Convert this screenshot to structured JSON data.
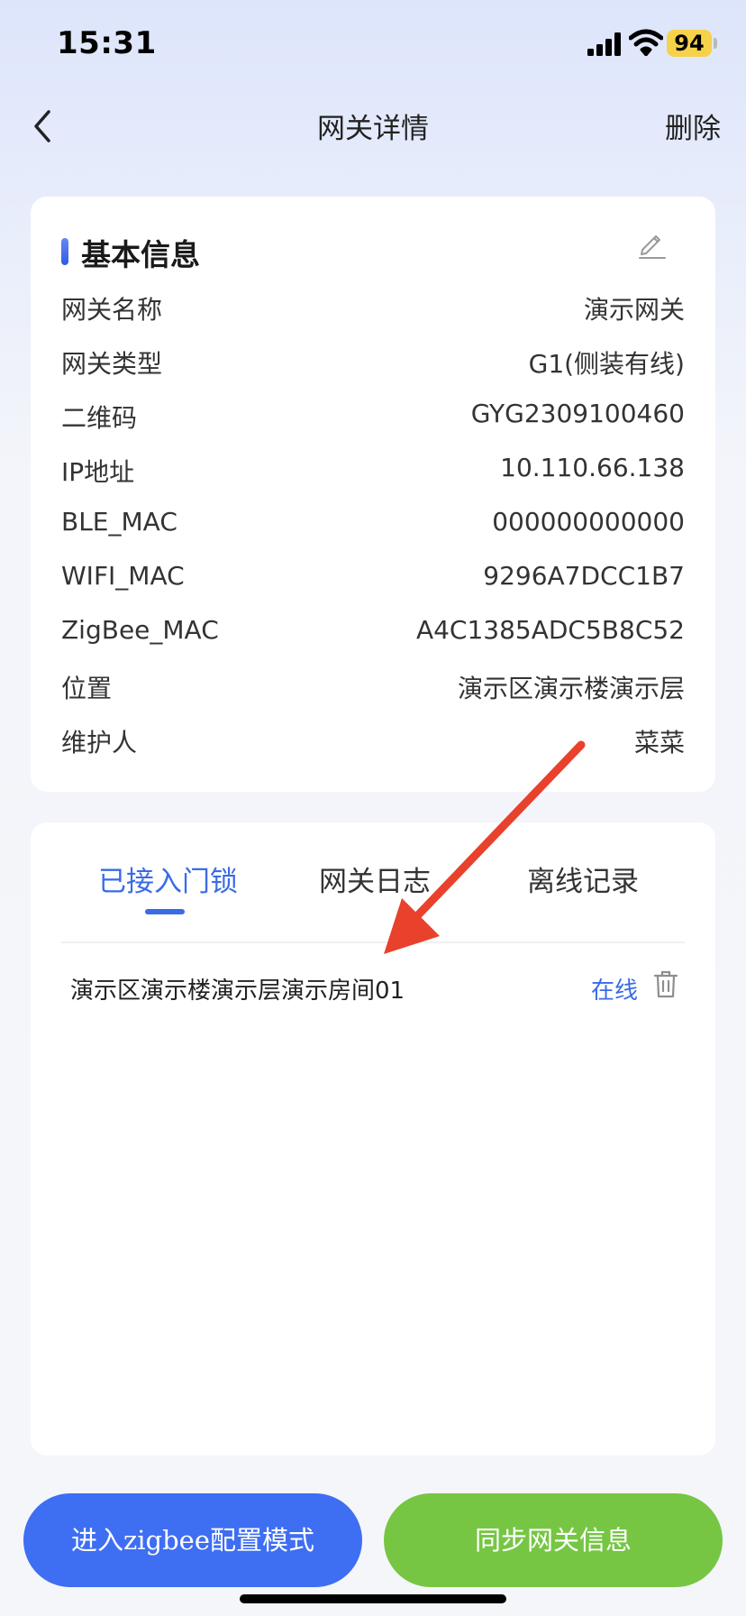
{
  "status_bar": {
    "time": "15:31",
    "battery": "94"
  },
  "nav": {
    "title": "网关详情",
    "delete_label": "删除"
  },
  "basic_info": {
    "title": "基本信息",
    "rows": [
      {
        "label": "网关名称",
        "value": "演示网关"
      },
      {
        "label": "网关类型",
        "value": "G1(侧装有线)"
      },
      {
        "label": "二维码",
        "value": "GYG2309100460"
      },
      {
        "label": "IP地址",
        "value": "10.110.66.138"
      },
      {
        "label": "BLE_MAC",
        "value": "000000000000"
      },
      {
        "label": "WIFI_MAC",
        "value": "9296A7DCC1B7"
      },
      {
        "label": "ZigBee_MAC",
        "value": "A4C1385ADC5B8C52"
      },
      {
        "label": "位置",
        "value": "演示区演示楼演示层"
      },
      {
        "label": "维护人",
        "value": "菜菜"
      }
    ]
  },
  "tabs": [
    {
      "label": "已接入门锁",
      "active": true
    },
    {
      "label": "网关日志",
      "active": false
    },
    {
      "label": "离线记录",
      "active": false
    }
  ],
  "locks": [
    {
      "name": "演示区演示楼演示层演示房间01",
      "status": "在线"
    }
  ],
  "buttons": {
    "zigbee": "进入zigbee配置模式",
    "sync": "同步网关信息"
  },
  "colors": {
    "accent": "#3a6be6",
    "primary_button": "#3e6ef2",
    "sync_button": "#76c643",
    "annotation_arrow": "#e8412c"
  }
}
